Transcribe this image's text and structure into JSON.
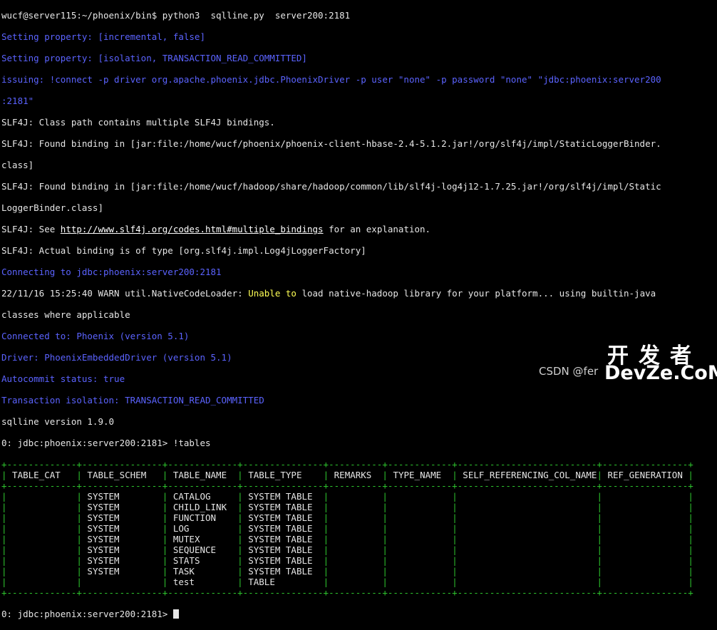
{
  "prompt_host": "wucf@server115:~/phoenix/bin$",
  "command": " python3  sqlline.py  server200:2181",
  "lines": [
    {
      "cls": "blue",
      "text": "Setting property: [incremental, false]"
    },
    {
      "cls": "blue",
      "text": "Setting property: [isolation, TRANSACTION_READ_COMMITTED]"
    },
    {
      "cls": "blue",
      "text": "issuing: !connect -p driver org.apache.phoenix.jdbc.PhoenixDriver -p user \"none\" -p password \"none\" \"jdbc:phoenix:server200"
    },
    {
      "cls": "blue",
      "text": ":2181\""
    },
    {
      "cls": "",
      "text": "SLF4J: Class path contains multiple SLF4J bindings."
    },
    {
      "cls": "",
      "text": "SLF4J: Found binding in [jar:file:/home/wucf/phoenix/phoenix-client-hbase-2.4-5.1.2.jar!/org/slf4j/impl/StaticLoggerBinder."
    },
    {
      "cls": "",
      "text": "class]"
    },
    {
      "cls": "",
      "text": "SLF4J: Found binding in [jar:file:/home/wucf/hadoop/share/hadoop/common/lib/slf4j-log4j12-1.7.25.jar!/org/slf4j/impl/Static"
    },
    {
      "cls": "",
      "text": "LoggerBinder.class]"
    }
  ],
  "see_line": {
    "prefix": "SLF4J: See ",
    "link": "http://www.slf4j.org/codes.html#multiple_bindings",
    "suffix": " for an explanation."
  },
  "lines2": [
    {
      "cls": "",
      "text": "SLF4J: Actual binding is of type [org.slf4j.impl.Log4jLoggerFactory]"
    },
    {
      "cls": "blue",
      "text": "Connecting to jdbc:phoenix:server200:2181"
    }
  ],
  "warn_line": {
    "prefix": "22/11/16 15:25:40 WARN util.NativeCodeLoader: ",
    "highlight": "Unable to",
    "suffix": " load native-hadoop library for your platform... using builtin-java"
  },
  "lines3": [
    {
      "cls": "",
      "text": "classes where applicable"
    },
    {
      "cls": "blue",
      "text": "Connected to: Phoenix (version 5.1)"
    },
    {
      "cls": "blue",
      "text": "Driver: PhoenixEmbeddedDriver (version 5.1)"
    },
    {
      "cls": "blue",
      "text": "Autocommit status: true"
    },
    {
      "cls": "blue",
      "text": "Transaction isolation: TRANSACTION_READ_COMMITTED"
    },
    {
      "cls": "",
      "text": "sqlline version 1.9.0"
    },
    {
      "cls": "",
      "text": "0: jdbc:phoenix:server200:2181> !tables"
    }
  ],
  "table": {
    "border_line": "+-------------+---------------+-------------+---------------+----------+------------+--------------------------+----------------+",
    "header_line": "| TABLE_CAT | TABLE_SCHEM | TABLE_NAME | TABLE_TYPE | REMARKS | TYPE_NAME | SELF_REFERENCING_COL_NAME | REF_GENERATION |",
    "columns": [
      "TABLE_CAT",
      "TABLE_SCHEM",
      "TABLE_NAME",
      "TABLE_TYPE",
      "REMARKS",
      "TYPE_NAME",
      "SELF_REFERENCING_COL_NAME",
      "REF_GENERATION"
    ],
    "rows": [
      [
        "",
        "SYSTEM",
        "CATALOG",
        "SYSTEM TABLE",
        "",
        "",
        "",
        ""
      ],
      [
        "",
        "SYSTEM",
        "CHILD_LINK",
        "SYSTEM TABLE",
        "",
        "",
        "",
        ""
      ],
      [
        "",
        "SYSTEM",
        "FUNCTION",
        "SYSTEM TABLE",
        "",
        "",
        "",
        ""
      ],
      [
        "",
        "SYSTEM",
        "LOG",
        "SYSTEM TABLE",
        "",
        "",
        "",
        ""
      ],
      [
        "",
        "SYSTEM",
        "MUTEX",
        "SYSTEM TABLE",
        "",
        "",
        "",
        ""
      ],
      [
        "",
        "SYSTEM",
        "SEQUENCE",
        "SYSTEM TABLE",
        "",
        "",
        "",
        ""
      ],
      [
        "",
        "SYSTEM",
        "STATS",
        "SYSTEM TABLE",
        "",
        "",
        "",
        ""
      ],
      [
        "",
        "SYSTEM",
        "TASK",
        "SYSTEM TABLE",
        "",
        "",
        "",
        ""
      ],
      [
        "",
        "",
        "test",
        "TABLE",
        "",
        "",
        "",
        ""
      ]
    ]
  },
  "final_prompt": "0: jdbc:phoenix:server200:2181> ",
  "watermark": {
    "csdn": "CSDN @fer",
    "cn": "开发者",
    "en": "DevZe.CoM"
  }
}
